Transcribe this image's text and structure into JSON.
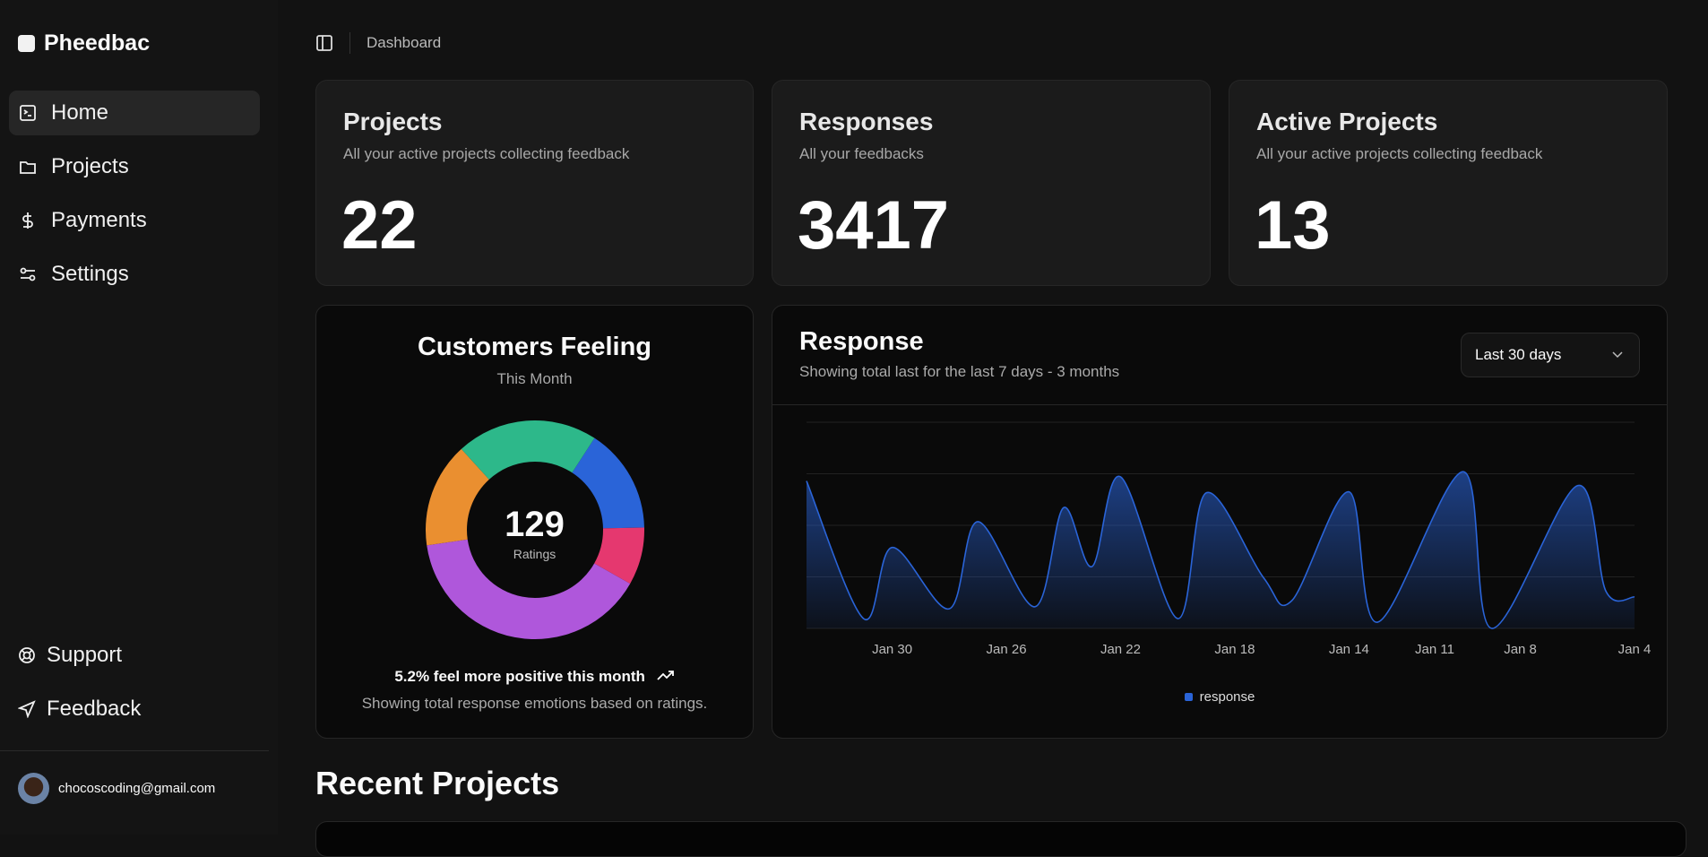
{
  "app": {
    "name": "Pheedbac"
  },
  "sidebar": {
    "items": [
      {
        "label": "Home",
        "icon": "terminal-square-icon",
        "active": true
      },
      {
        "label": "Projects",
        "icon": "folder-icon"
      },
      {
        "label": "Payments",
        "icon": "dollar-icon"
      },
      {
        "label": "Settings",
        "icon": "sliders-icon"
      }
    ],
    "bottom": [
      {
        "label": "Support",
        "icon": "life-buoy-icon"
      },
      {
        "label": "Feedback",
        "icon": "send-icon"
      }
    ],
    "user": {
      "email": "chocoscoding@gmail.com"
    }
  },
  "header": {
    "breadcrumb": "Dashboard"
  },
  "stats": [
    {
      "title": "Projects",
      "subtitle": "All your active projects collecting feedback",
      "value": "22"
    },
    {
      "title": "Responses",
      "subtitle": "All your feedbacks",
      "value": "3417"
    },
    {
      "title": "Active Projects",
      "subtitle": "All your active projects collecting feedback",
      "value": "13"
    }
  ],
  "feeling": {
    "title": "Customers Feeling",
    "subtitle": "This Month",
    "total": "129",
    "total_label": "Ratings",
    "trend": "5.2% feel more positive this month",
    "footer": "Showing total response emotions based on ratings."
  },
  "response": {
    "title": "Response",
    "subtitle": "Showing total last for the last 7 days - 3 months",
    "range": "Last 30 days"
  },
  "recent": {
    "title": "Recent Projects"
  },
  "chart_data": [
    {
      "type": "pie",
      "donut": true,
      "values": [
        20,
        11,
        51,
        20,
        27
      ],
      "colors": [
        "#2a64d8",
        "#e5386f",
        "#af57db",
        "#ea8f30",
        "#2db88a"
      ]
    },
    {
      "type": "area",
      "x_order": "descending",
      "x_ticks": [
        "Jan 30",
        "Jan 26",
        "Jan 22",
        "Jan 18",
        "Jan 14",
        "Jan 11",
        "Jan 8",
        "Jan 4"
      ],
      "series": [
        {
          "name": "response",
          "color": "#2a64d8",
          "points": [
            [
              "Feb 2",
              286
            ],
            [
              "Jan 31",
              19
            ],
            [
              "Jan 30",
              157
            ],
            [
              "Jan 28",
              38
            ],
            [
              "Jan 27",
              207
            ],
            [
              "Jan 25",
              42
            ],
            [
              "Jan 24",
              234
            ],
            [
              "Jan 23",
              120
            ],
            [
              "Jan 22",
              294
            ],
            [
              "Jan 20",
              19
            ],
            [
              "Jan 19",
              263
            ],
            [
              "Jan 17",
              99
            ],
            [
              "Jan 16",
              54
            ],
            [
              "Jan 14",
              265
            ],
            [
              "Jan 13",
              12
            ],
            [
              "Jan 10",
              304
            ],
            [
              "Jan 9",
              0
            ],
            [
              "Jan 6",
              277
            ],
            [
              "Jan 5",
              72
            ],
            [
              "Jan 4",
              61
            ]
          ]
        }
      ],
      "ylim": [
        0,
        400
      ],
      "grid": "horizontal",
      "legend": "bottom"
    }
  ]
}
